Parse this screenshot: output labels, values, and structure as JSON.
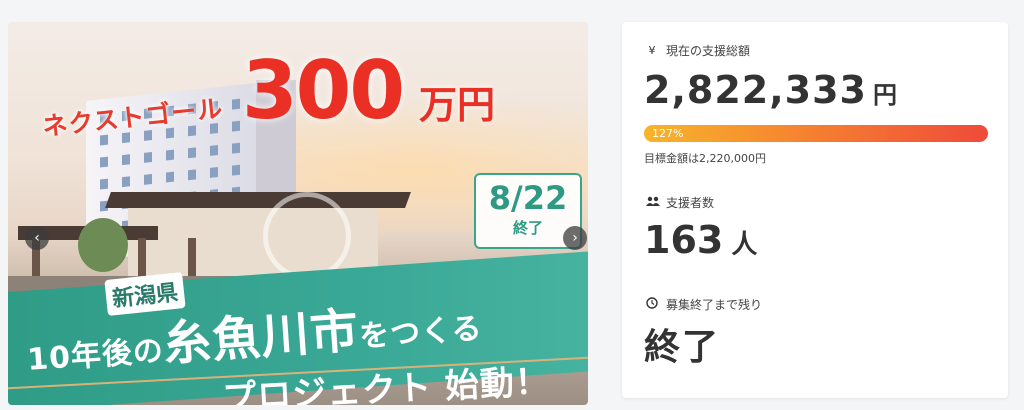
{
  "hero": {
    "goal_label": "ネクストゴール",
    "goal_value": "300",
    "goal_unit": "万円",
    "end_date": "8/22",
    "end_label": "終了",
    "prefecture": "新潟県",
    "title_line1_pre": "10年後の",
    "title_line1_big": "糸魚川市",
    "title_line1_post": "をつくる",
    "title_line2": "プロジェクト 始動！",
    "prev_icon": "‹",
    "next_icon": "›"
  },
  "stats": {
    "total_label": "現在の支援総額",
    "total_icon": "¥",
    "total_amount": "2,822,333",
    "total_unit": "円",
    "progress_text": "127%",
    "progress_percent": 127,
    "goal_text": "目標金額は2,220,000円",
    "supporters_label": "支援者数",
    "supporters_count": "163",
    "supporters_unit": "人",
    "remaining_label": "募集終了まで残り",
    "remaining_value": "終了"
  },
  "colors": {
    "accent_red": "#ea2f25",
    "teal": "#2f9c86",
    "bar_start": "#f7b52c",
    "bar_end": "#ef4a3a"
  }
}
